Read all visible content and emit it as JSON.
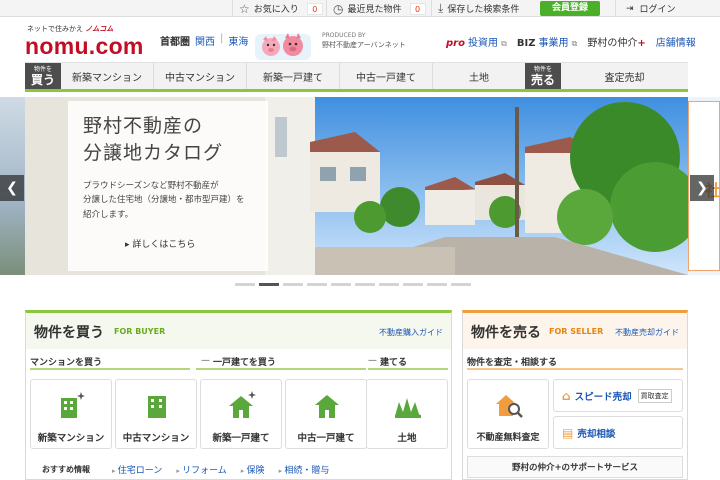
{
  "topbar": {
    "favorites_label": "お気に入り",
    "favorites_count": "0",
    "recent_label": "最近見た物件",
    "recent_count": "0",
    "saved_label": "保存した検索条件",
    "member_label": "会員登録",
    "login_label": "ログイン"
  },
  "header": {
    "tagline_prefix": "ネットで住みかえ",
    "tagline_brand": "ノムコム",
    "logo": "nomu.com",
    "region_current": "首都圏",
    "region_kansai": "関西",
    "region_sep": "|",
    "region_tokai": "東海",
    "produced_by": "PRODUCED BY",
    "network": "野村不動産アーバンネット",
    "pro_prefix": "pro",
    "pro_label": "投資用",
    "biz_prefix": "BIZ",
    "biz_label": "事業用",
    "agent_label": "野村の仲介",
    "agent_plus": "+",
    "store_label": "店舗情報"
  },
  "nav": {
    "buy_small": "物件を",
    "buy_big": "買う",
    "buy_items": [
      "新築マンション",
      "中古マンション",
      "新築一戸建て",
      "中古一戸建て",
      "土地"
    ],
    "sell_small": "物件を",
    "sell_big": "売る",
    "sell_item": "査定売却"
  },
  "hero": {
    "title_line1": "野村不動産の",
    "title_line2": "分譲地カタログ",
    "desc_line1": "プラウドシーズンなど野村不動産が",
    "desc_line2": "分譲した住宅地（分譲地・都市型戸建）を",
    "desc_line3": "紹介します。",
    "more": "▸ 詳しくはこちら",
    "side_text": "社",
    "prev": "❮",
    "next": "❯"
  },
  "buy_box": {
    "title": "物件を買う",
    "subtitle": "FOR BUYER",
    "guide": "不動産購入ガイド",
    "sub_mansion": "マンションを買う",
    "sub_house": "一戸建てを買う",
    "sub_build": "建てる",
    "tiles": [
      "新築マンション",
      "中古マンション",
      "新築一戸建て",
      "中古一戸建て",
      "土地"
    ],
    "recommend_label": "おすすめ情報",
    "recommend_links": [
      "住宅ローン",
      "リフォーム",
      "保険",
      "相続・贈与"
    ]
  },
  "sell_box": {
    "title": "物件を売る",
    "subtitle": "FOR SELLER",
    "guide": "不動産売却ガイド",
    "sub_assess": "物件を査定・相談する",
    "free_assess": "不動産無料査定",
    "speed_sale": "スピード売却",
    "buyback_tag": "買取査定",
    "consult": "売却相談",
    "support": "野村の仲介+のサポートサービス"
  },
  "colors": {
    "brand_red": "#c30d23",
    "buy_green": "#8cc63f",
    "sell_orange": "#f29c40",
    "link_blue": "#1a56b5"
  }
}
